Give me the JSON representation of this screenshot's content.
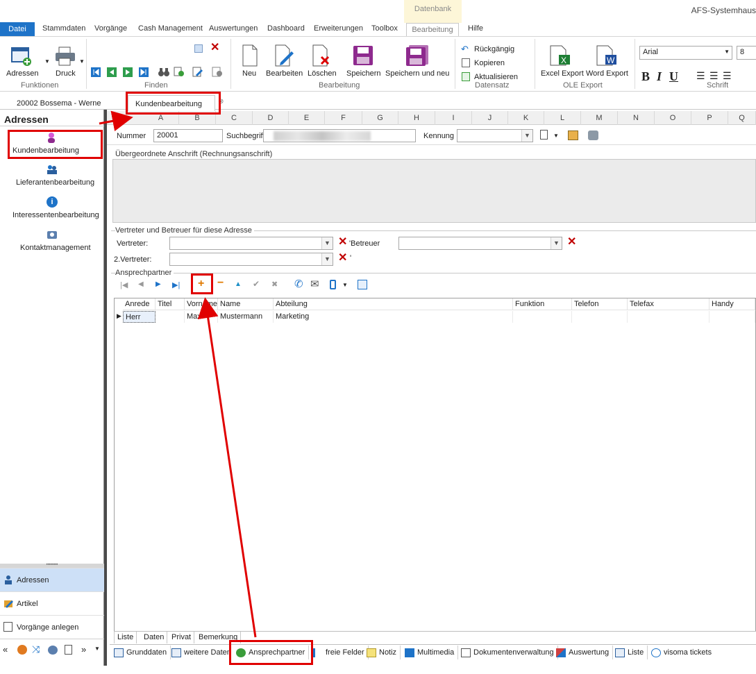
{
  "app": {
    "title": "AFS-Systemhaus",
    "context_tab": "Datenbank"
  },
  "menu": [
    "Datei",
    "Stammdaten",
    "Vorgänge",
    "Cash Management",
    "Auswertungen",
    "Dashboard",
    "Erweiterungen",
    "Toolbox",
    "Bearbeitung",
    "Hilfe"
  ],
  "ribbon": {
    "funktionen": {
      "label": "Funktionen",
      "adressen": "Adressen",
      "druck": "Druck"
    },
    "finden": {
      "label": "Finden"
    },
    "bearbeitung": {
      "label": "Bearbeitung",
      "neu": "Neu",
      "bearbeiten": "Bearbeiten",
      "loeschen": "Löschen",
      "speichern": "Speichern",
      "speichern_neu": "Speichern und neu"
    },
    "datensatz": {
      "label": "Datensatz",
      "rueckgaengig": "Rückgängig",
      "kopieren": "Kopieren",
      "aktualisieren": "Aktualisieren"
    },
    "ole": {
      "label": "OLE Export",
      "excel": "Excel Export",
      "word": "Word Export"
    },
    "schrift": {
      "label": "Schrift",
      "font": "Arial",
      "size": "8",
      "bold": "B",
      "italic": "I",
      "underline": "U"
    }
  },
  "doc_tabs": {
    "record": "20002 Bossema - Werne",
    "active": "Kundenbearbeitung"
  },
  "left": {
    "title": "Adressen",
    "items": [
      "Kundenbearbeitung",
      "Lieferantenbearbeitung",
      "Interessentenbearbeitung",
      "Kontaktmanagement"
    ],
    "nav": [
      "Adressen",
      "Artikel",
      "Vorgänge anlegen"
    ]
  },
  "columns": [
    "A",
    "B",
    "C",
    "D",
    "E",
    "F",
    "G",
    "H",
    "I",
    "J",
    "K",
    "L",
    "M",
    "N",
    "O",
    "P",
    "Q"
  ],
  "form": {
    "nummer_label": "Nummer",
    "nummer": "20001",
    "suchbegriff_label": "Suchbegriff:",
    "kennung_label": "Kennung",
    "anschrift_title": "Übergeordnete Anschrift (Rechnungsanschrift)",
    "vertreter_title": "Vertreter und Betreuer für diese Adresse",
    "vertreter_label": "Vertreter:",
    "betreuer_label": "Betreuer",
    "vertreter2_label": "2.Vertreter:",
    "ansprech_title": "Ansprechpartner"
  },
  "table": {
    "headers": [
      "Anrede",
      "Titel",
      "Vorname",
      "Name",
      "Abteilung",
      "Funktion",
      "Telefon",
      "Telefax",
      "Handy"
    ],
    "rows": [
      [
        "Herr",
        "",
        "Max",
        "Mustermann",
        "Marketing",
        "",
        "",
        "",
        ""
      ]
    ]
  },
  "sub_tabs": [
    "Liste",
    "Daten",
    "Privat",
    "Bemerkung"
  ],
  "bottom_tabs": [
    "Grunddaten",
    "weitere Daten",
    "Ansprechpartner",
    "freie Felder",
    "Notiz",
    "Multimedia",
    "Dokumentenverwaltung",
    "Auswertung",
    "Liste",
    "visoma tickets"
  ],
  "colors": {
    "accent": "#1e73c8",
    "annotation": "#e00000",
    "purple": "#8e2a8e"
  }
}
